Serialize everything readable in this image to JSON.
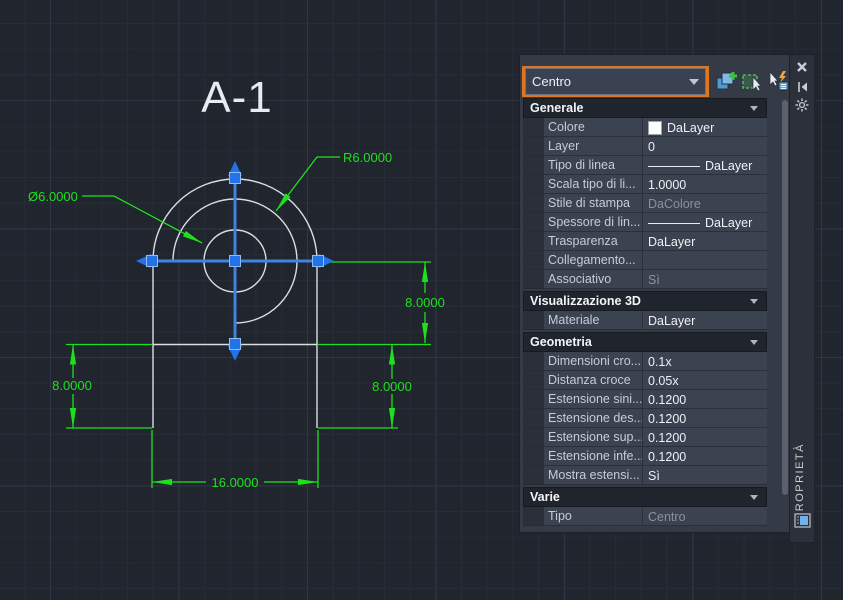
{
  "drawing": {
    "view_label": "A-1",
    "dims": {
      "radius": "R6.0000",
      "diameter": "Ø6.0000",
      "right_top": "8.0000",
      "right_bottom": "8.0000",
      "left": "8.0000",
      "width": "16.0000"
    }
  },
  "palette": {
    "selector": {
      "value": "Centro"
    },
    "rail_title": "PROPRIETÀ",
    "icons": {
      "pickadd": "toggle-pickadd-icon",
      "select_objects": "select-objects-icon",
      "quick_select": "quick-select-icon",
      "close": "close-icon",
      "autohide": "auto-hide-icon",
      "settings": "settings-icon",
      "properties": "properties-palette-icon"
    },
    "sections": [
      {
        "title": "Generale",
        "rows": [
          {
            "label": "Colore",
            "value": "DaLayer"
          },
          {
            "label": "Layer",
            "value": "0"
          },
          {
            "label": "Tipo di linea",
            "value": "DaLayer"
          },
          {
            "label": "Scala tipo di li...",
            "value": "1.0000"
          },
          {
            "label": "Stile di stampa",
            "value": "DaColore"
          },
          {
            "label": "Spessore di lin...",
            "value": "DaLayer"
          },
          {
            "label": "Trasparenza",
            "value": "DaLayer"
          },
          {
            "label": "Collegamento...",
            "value": ""
          },
          {
            "label": "Associativo",
            "value": "Sì"
          }
        ]
      },
      {
        "title": "Visualizzazione 3D",
        "rows": [
          {
            "label": "Materiale",
            "value": "DaLayer"
          }
        ]
      },
      {
        "title": "Geometria",
        "rows": [
          {
            "label": "Dimensioni cro...",
            "value": "0.1x"
          },
          {
            "label": "Distanza croce",
            "value": "0.05x"
          },
          {
            "label": "Estensione sini...",
            "value": "0.1200"
          },
          {
            "label": "Estensione des...",
            "value": "0.1200"
          },
          {
            "label": "Estensione sup...",
            "value": "0.1200"
          },
          {
            "label": "Estensione infe...",
            "value": "0.1200"
          },
          {
            "label": "Mostra estensi...",
            "value": "Sì"
          }
        ]
      },
      {
        "title": "Varie",
        "rows": [
          {
            "label": "Tipo",
            "value": "Centro"
          }
        ]
      }
    ]
  },
  "colors": {
    "accent_orange": "#E0751F",
    "dimension_green": "#1FE01F",
    "grip_blue": "#2472E8",
    "geometry_white": "#D9DEE3",
    "panel_bg": "#343B47",
    "row_bg": "#3B4250",
    "section_bg": "#20252D"
  }
}
